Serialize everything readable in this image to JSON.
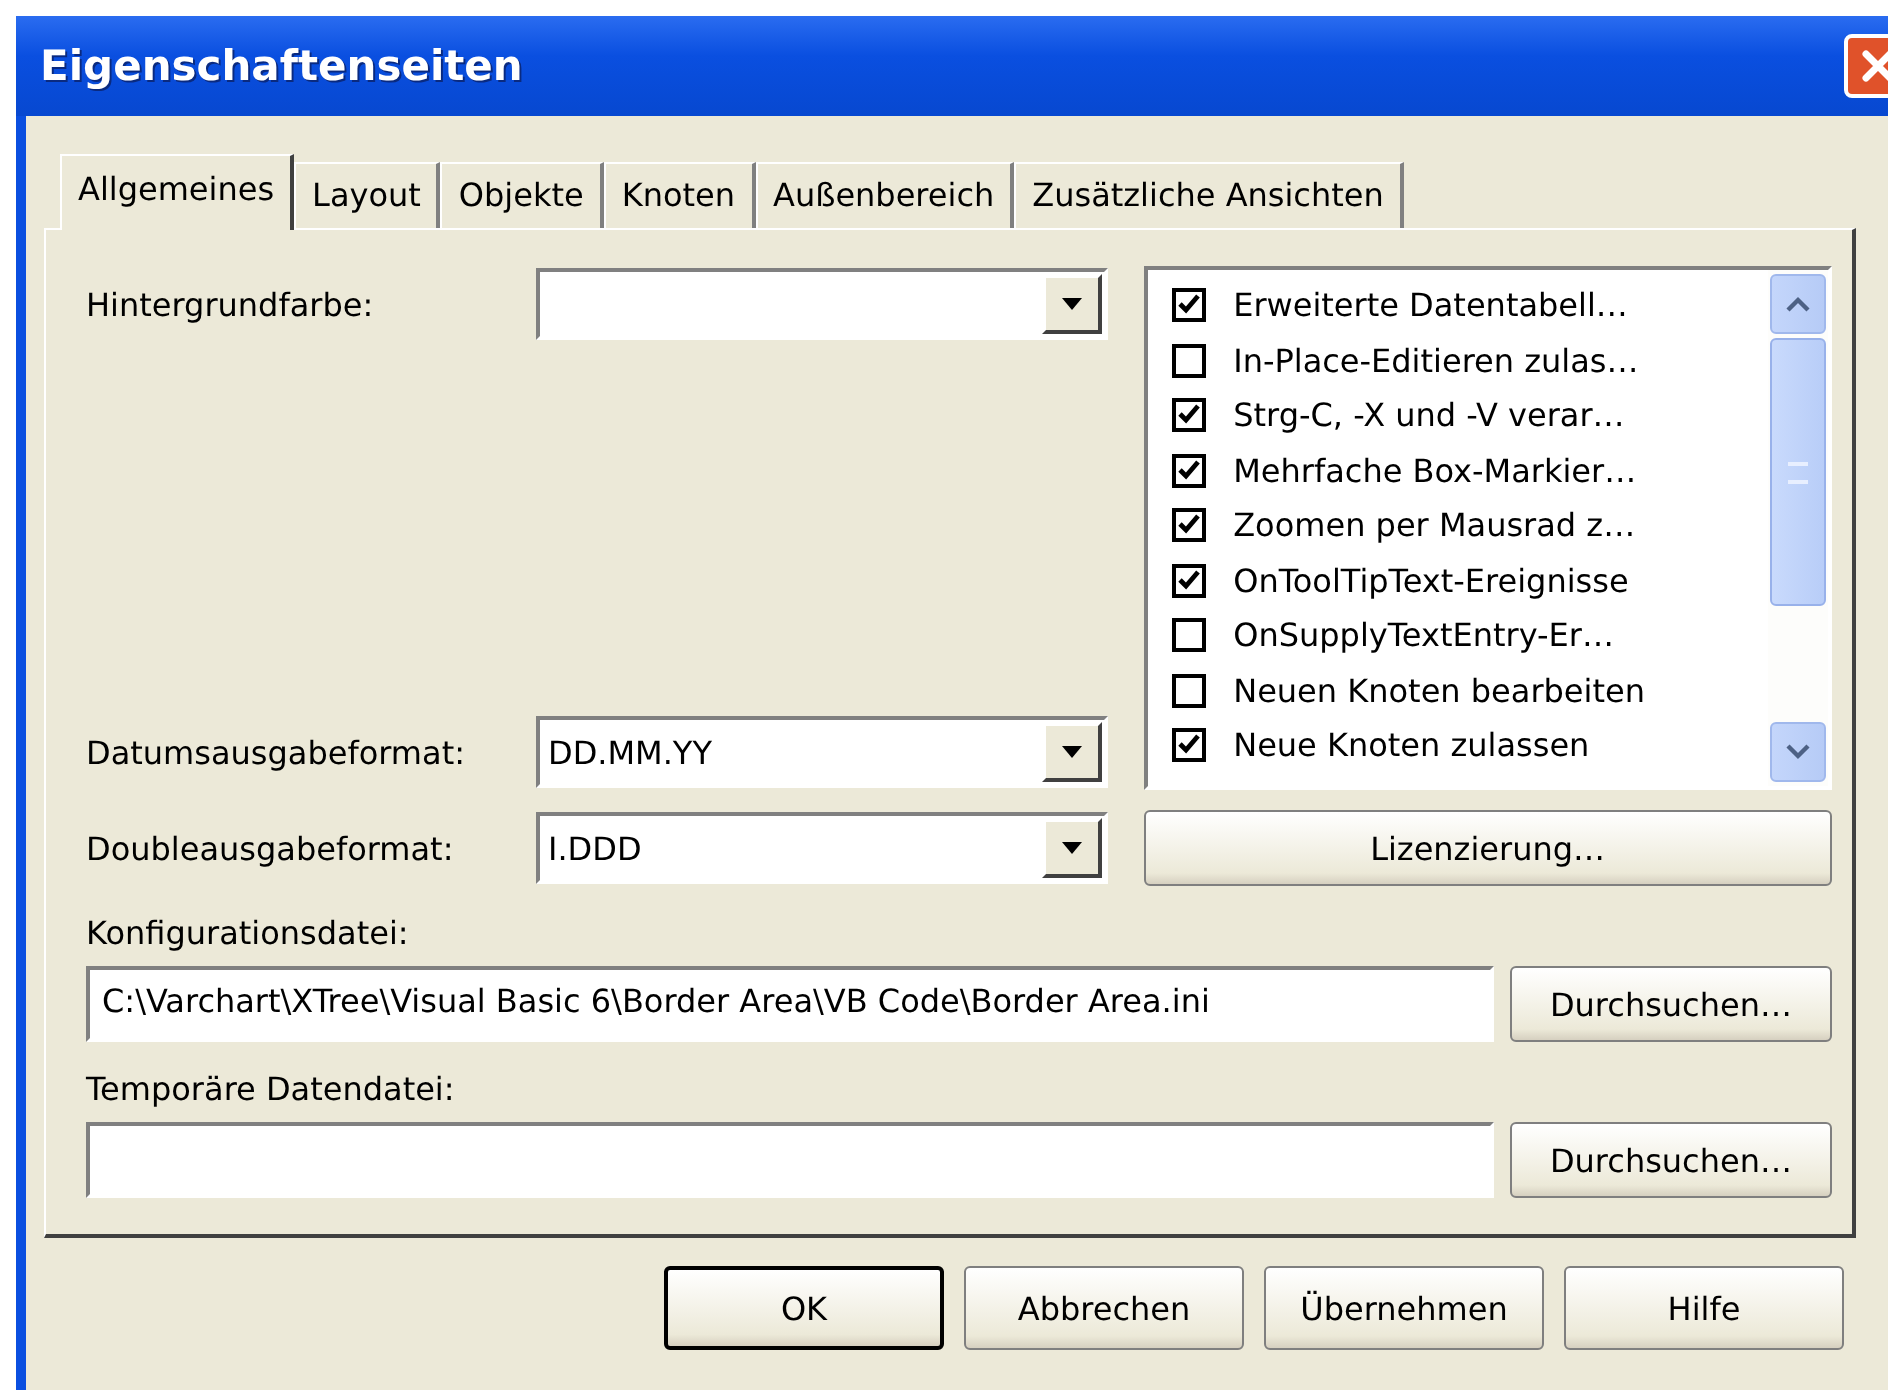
{
  "window": {
    "title": "Eigenschaftenseiten"
  },
  "tabs": [
    {
      "label": "Allgemeines",
      "selected": true
    },
    {
      "label": "Layout",
      "selected": false
    },
    {
      "label": "Objekte",
      "selected": false
    },
    {
      "label": "Knoten",
      "selected": false
    },
    {
      "label": "Außenbereich",
      "selected": false
    },
    {
      "label": "Zusätzliche Ansichten",
      "selected": false
    }
  ],
  "background_color": {
    "label": "Hintergrundfarbe:"
  },
  "date_format": {
    "label": "Datumsausgabeformat:",
    "value": "DD.MM.YY"
  },
  "double_format": {
    "label": "Doubleausgabeformat:",
    "value": "I.DDD"
  },
  "options": [
    {
      "label": "Erweiterte Datentabell…",
      "checked": true
    },
    {
      "label": "In-Place-Editieren zulas…",
      "checked": false
    },
    {
      "label": "Strg-C, -X und -V verar…",
      "checked": true
    },
    {
      "label": "Mehrfache Box-Markier…",
      "checked": true
    },
    {
      "label": "Zoomen per Mausrad z…",
      "checked": true
    },
    {
      "label": "OnToolTipText-Ereignisse",
      "checked": true
    },
    {
      "label": "OnSupplyTextEntry-Er…",
      "checked": false
    },
    {
      "label": "Neuen Knoten bearbeiten",
      "checked": false
    },
    {
      "label": "Neue Knoten zulassen",
      "checked": true
    }
  ],
  "license_button": {
    "label": "Lizenzierung…"
  },
  "config_file": {
    "label": "Konfigurationsdatei:",
    "value": "C:\\Varchart\\XTree\\Visual Basic 6\\Border Area\\VB Code\\Border Area.ini",
    "button": "Durchsuchen…"
  },
  "temp_file": {
    "label": "Temporäre Datendatei:",
    "button": "Durchsuchen…"
  },
  "buttons": [
    {
      "label": "OK",
      "default": true
    },
    {
      "label": "Abbrechen",
      "default": false
    },
    {
      "label": "Übernehmen",
      "default": false
    },
    {
      "label": "Hilfe",
      "default": false
    }
  ]
}
